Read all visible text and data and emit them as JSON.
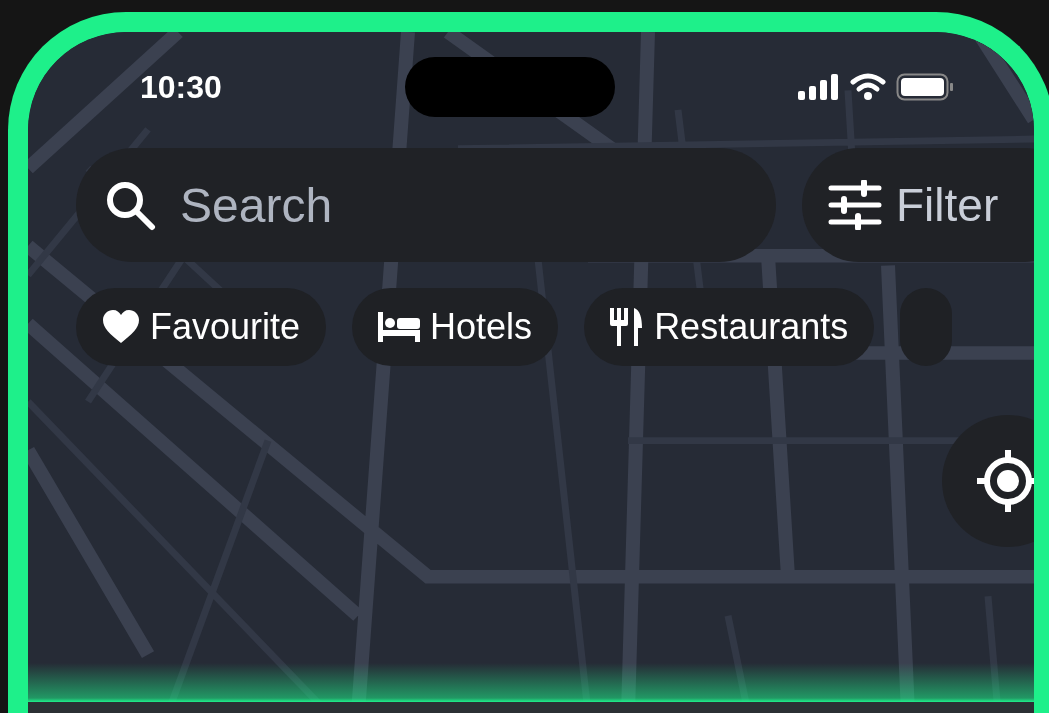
{
  "status_bar": {
    "time": "10:30"
  },
  "search": {
    "placeholder": "Search"
  },
  "filter_button": {
    "label": "Filter"
  },
  "chips": [
    {
      "kind": "heart",
      "label": "Favourite"
    },
    {
      "kind": "bed",
      "label": "Hotels"
    },
    {
      "kind": "cutlery",
      "label": "Restaurants"
    },
    {
      "kind": "partial"
    }
  ]
}
